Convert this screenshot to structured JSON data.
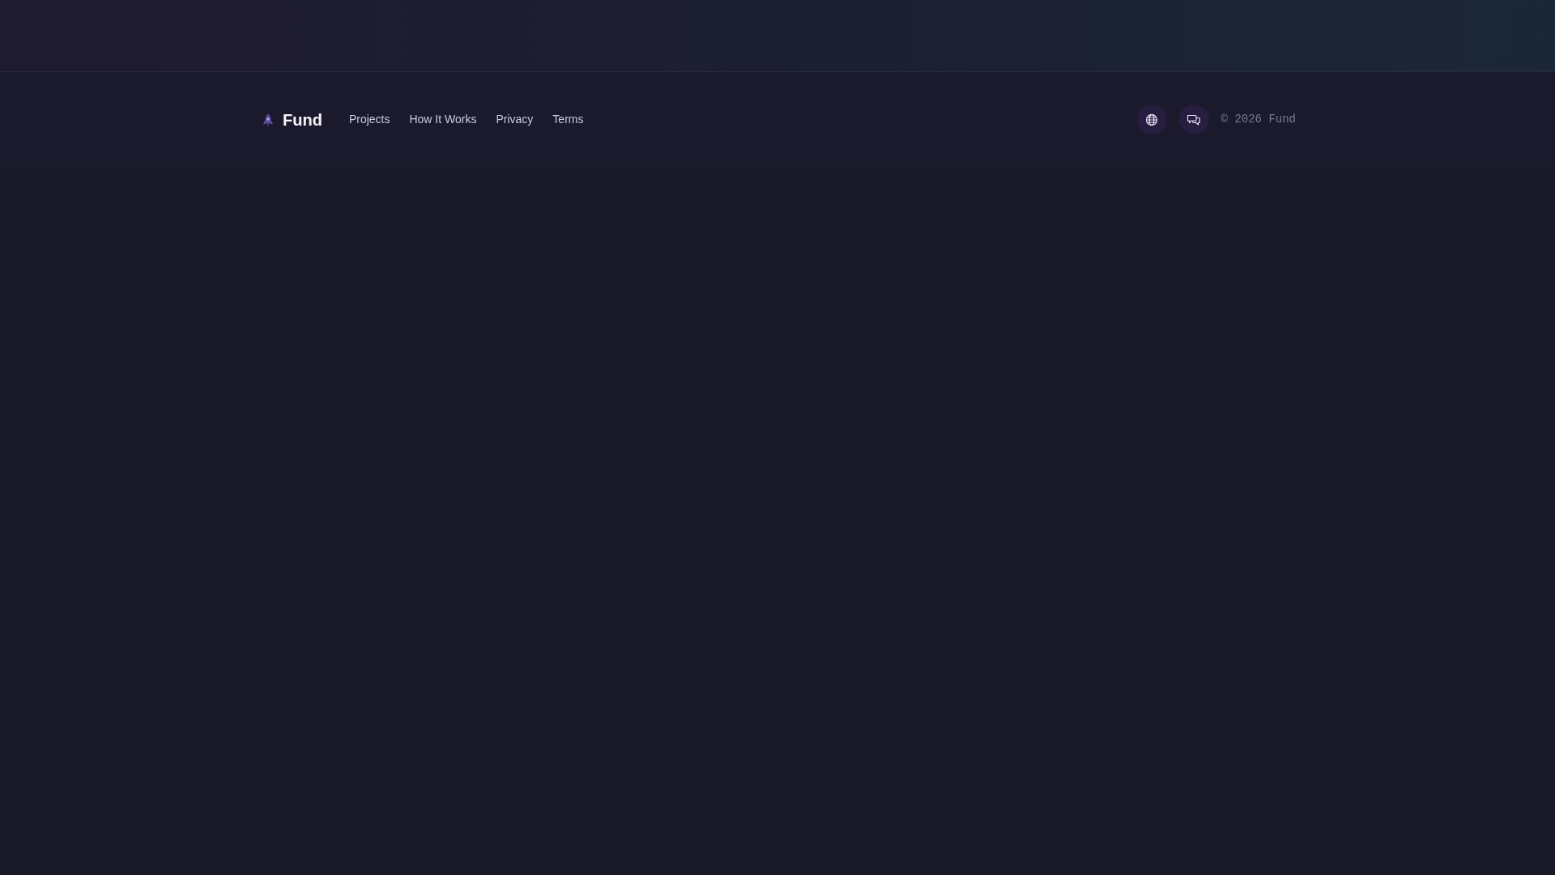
{
  "brand": {
    "name": "Fund"
  },
  "nav_links": [
    {
      "label": "Projects"
    },
    {
      "label": "How It Works"
    },
    {
      "label": "Privacy"
    },
    {
      "label": "Terms"
    }
  ],
  "social_buttons": [
    {
      "kind": "globe"
    },
    {
      "kind": "chat"
    }
  ],
  "copyright": "© 2026 Fund"
}
